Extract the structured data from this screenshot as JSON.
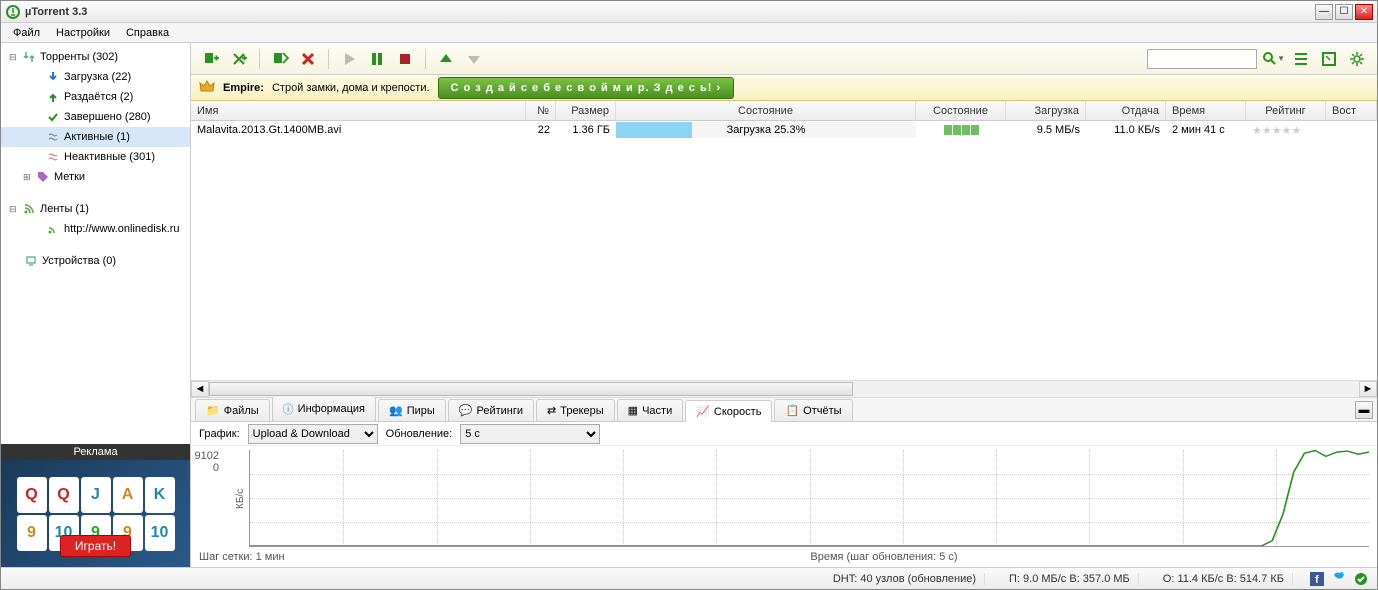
{
  "window": {
    "title": "µTorrent 3.3"
  },
  "menu": {
    "file": "Файл",
    "settings": "Настройки",
    "help": "Справка"
  },
  "sidebar": {
    "torrents": "Торренты (302)",
    "downloading": "Загрузка (22)",
    "seeding": "Раздаётся (2)",
    "completed": "Завершено (280)",
    "active": "Активные (1)",
    "inactive": "Неактивные (301)",
    "labels": "Метки",
    "feeds": "Ленты (1)",
    "feed1": "http://www.onlinedisk.ru",
    "devices": "Устройства (0)"
  },
  "ad": {
    "title": "Реклама",
    "btn": "Играть!"
  },
  "promo": {
    "title": "Empire:",
    "text": "Строй замки, дома и крепости.",
    "btn": "С о з д а й с е б е  с в о й м и р. З д е с ь! ›"
  },
  "columns": {
    "name": "Имя",
    "num": "№",
    "size": "Размер",
    "status": "Состояние",
    "health": "Состояние",
    "down": "Загрузка",
    "up": "Отдача",
    "time": "Время",
    "rating": "Рейтинг",
    "rest": "Вост"
  },
  "torrent": {
    "name": "Malavita.2013.Gt.1400MB.avi",
    "num": "22",
    "size": "1.36 ГБ",
    "statusText": "Загрузка 25.3%",
    "progressPct": 25.3,
    "down": "9.5 МБ/s",
    "up": "11.0 КБ/s",
    "time": "2 мин 41 с"
  },
  "tabs": {
    "files": "Файлы",
    "info": "Информация",
    "peers": "Пиры",
    "ratings": "Рейтинги",
    "trackers": "Трекеры",
    "pieces": "Части",
    "speed": "Скорость",
    "reports": "Отчёты"
  },
  "chart_options": {
    "graph_label": "График:",
    "graph_value": "Upload & Download",
    "update_label": "Обновление:",
    "update_value": "5 с"
  },
  "chart_data": {
    "type": "line",
    "ylabel": "КБ/с",
    "ymax": "9102",
    "ymin": "0",
    "xlabel_left": "Шаг сетки: 1 мин",
    "xlabel_center": "Время (шаг обновления: 5 с)",
    "series": [
      {
        "name": "download",
        "color": "#2a9020",
        "values": [
          0,
          0,
          0,
          0,
          0,
          0,
          0,
          0,
          0,
          0,
          0,
          0,
          0,
          0,
          0,
          0,
          0,
          0,
          0,
          0,
          0,
          0,
          0,
          0,
          0,
          0,
          0,
          0,
          0,
          0,
          0,
          0,
          0,
          0,
          0,
          0,
          0,
          0,
          0,
          0,
          0,
          0,
          0,
          0,
          0,
          0,
          0,
          0,
          0,
          0,
          0,
          0,
          0,
          0,
          0,
          0,
          0,
          0,
          0,
          0,
          0,
          0,
          0,
          0,
          0,
          0,
          0,
          0,
          0,
          0,
          0,
          0,
          0,
          0,
          0,
          0,
          0,
          0,
          0,
          0,
          0,
          0,
          0,
          0,
          0,
          0,
          0,
          0,
          0,
          0,
          0,
          0,
          0,
          0,
          0,
          500,
          3000,
          7000,
          8800,
          9050,
          8500,
          8900,
          9000,
          8700,
          8900
        ]
      }
    ]
  },
  "status": {
    "dht": "DHT: 40 узлов (обновление)",
    "down": "П: 9.0 МБ/с В: 357.0 МБ",
    "up": "О: 11.4 КБ/с В: 514.7 КБ"
  },
  "colors": {
    "accent": "#6dc060"
  }
}
